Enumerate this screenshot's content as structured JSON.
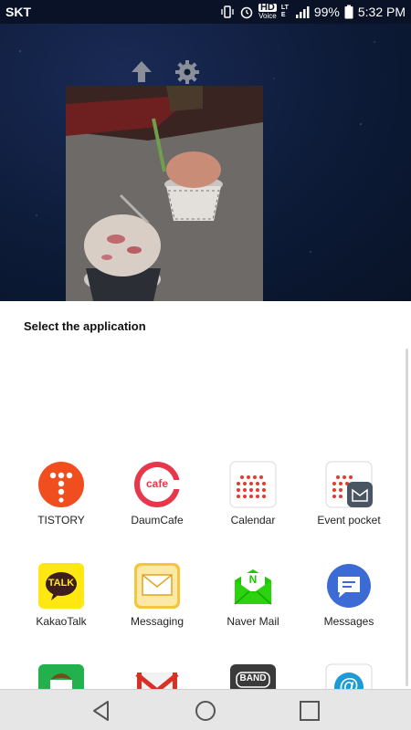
{
  "status_bar": {
    "carrier": "SKT",
    "hd_label": "HD",
    "voice_label": "Voice",
    "lte_label": "LTE",
    "battery": "99%",
    "time": "5:32 PM"
  },
  "toolbar": {
    "share_icon": "upload-arrow-icon",
    "settings_icon": "gear-icon"
  },
  "sheet": {
    "title": "Select the application"
  },
  "apps": [
    {
      "label": "TISTORY",
      "icon": "tistory-icon"
    },
    {
      "label": "DaumCafe",
      "icon": "daumcafe-icon",
      "icon_text": "cafe"
    },
    {
      "label": "Calendar",
      "icon": "calendar-icon"
    },
    {
      "label": "Event pocket",
      "icon": "event-pocket-icon"
    },
    {
      "label": "KakaoTalk",
      "icon": "kakaotalk-icon",
      "icon_text": "TALK"
    },
    {
      "label": "Messaging",
      "icon": "messaging-icon"
    },
    {
      "label": "Naver Mail",
      "icon": "naver-mail-icon",
      "icon_text": "N"
    },
    {
      "label": "Messages",
      "icon": "messages-icon"
    }
  ],
  "partial_apps": [
    {
      "icon": "green-app-icon"
    },
    {
      "icon": "gmail-icon"
    },
    {
      "icon": "band-icon",
      "icon_text": "BAND"
    },
    {
      "icon": "email-icon",
      "icon_text": "@"
    }
  ],
  "colors": {
    "tistory": "#f04e1e",
    "daumcafe": "#e8364a",
    "kakao": "#ffe812",
    "messaging": "#f5c63b",
    "naver": "#1ec800",
    "messages": "#3d6bd6"
  }
}
